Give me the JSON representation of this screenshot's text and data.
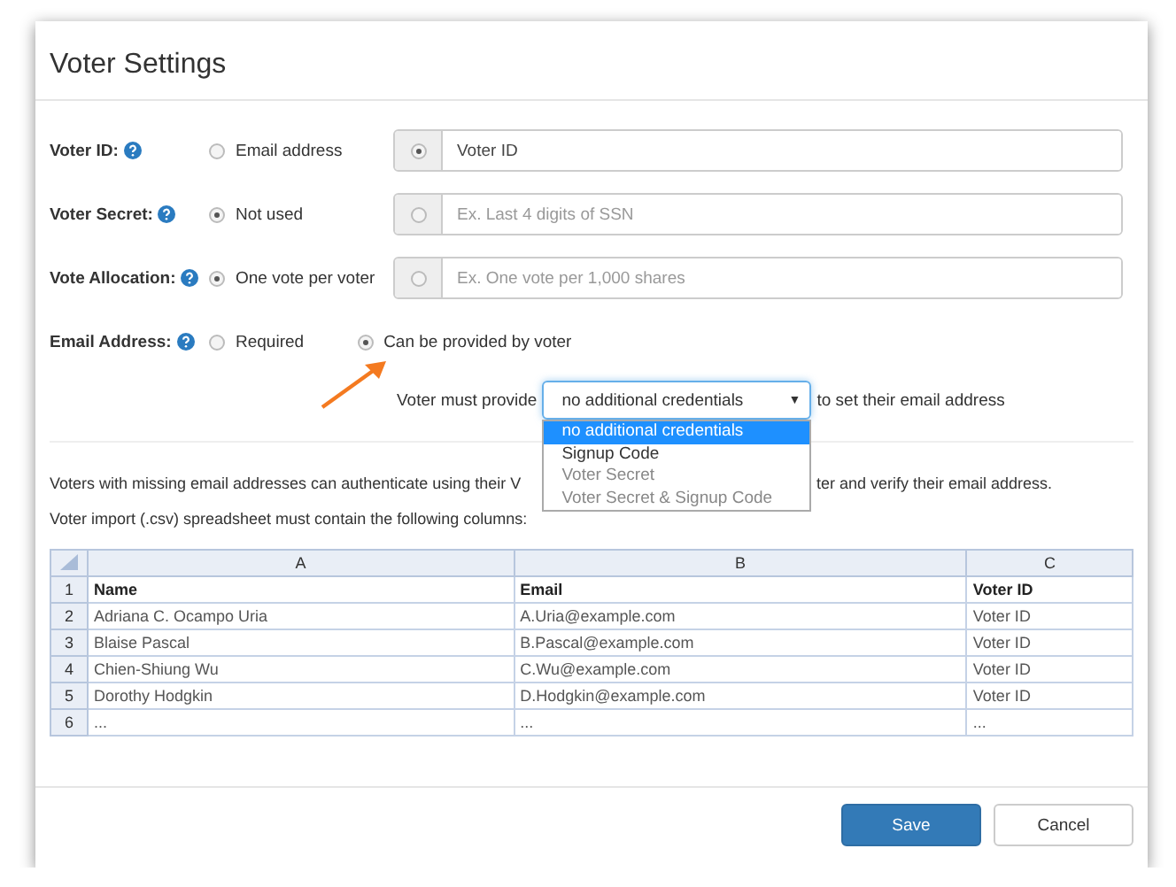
{
  "window": {
    "title": "Voter Settings"
  },
  "settings": [
    {
      "label": "Voter ID:",
      "options": [
        {
          "label": "Email address",
          "selected": false
        }
      ],
      "field": {
        "selected": true,
        "value": "Voter ID"
      }
    },
    {
      "label": "Voter Secret:",
      "options": [
        {
          "label": "Not used",
          "selected": true
        }
      ],
      "field": {
        "selected": false,
        "placeholder": "Ex. Last 4 digits of SSN"
      }
    },
    {
      "label": "Vote Allocation:",
      "options": [
        {
          "label": "One vote per voter",
          "selected": true
        }
      ],
      "field": {
        "selected": false,
        "placeholder": "Ex. One vote per 1,000 shares"
      }
    },
    {
      "label": "Email Address:",
      "options": [
        {
          "label": "Required",
          "selected": false
        },
        {
          "label": "Can be provided by voter",
          "selected": true
        }
      ]
    }
  ],
  "credentials": {
    "prefix": "Voter must provide",
    "select": {
      "value": "no additional credentials",
      "caret": "▼",
      "expanded": true,
      "options": [
        {
          "label": "no additional credentials",
          "selected": true,
          "disabled": false
        },
        {
          "label": "Signup Code",
          "selected": false,
          "disabled": false
        },
        {
          "label": "Voter Secret",
          "selected": false,
          "disabled": true
        },
        {
          "label": "Voter Secret & Signup Code",
          "selected": false,
          "disabled": true
        }
      ]
    },
    "suffix": "to set their email address"
  },
  "notes": [
    {
      "before": "Voters with missing email addresses can authenticate using their V",
      "after": "ter and verify their email address."
    },
    {
      "before": "Voter import (.csv) spreadsheet must contain the following columns:"
    }
  ],
  "spreadsheet": {
    "columns": [
      "A",
      "B",
      "C"
    ],
    "rows": [
      {
        "number": "1",
        "kind": "header",
        "cells": [
          "Name",
          "Email",
          "Voter ID"
        ]
      },
      {
        "number": "2",
        "kind": "data",
        "cells": [
          "Adriana C. Ocampo Uria",
          "A.Uria@example.com",
          "Voter ID"
        ]
      },
      {
        "number": "3",
        "kind": "data",
        "cells": [
          "Blaise Pascal",
          "B.Pascal@example.com",
          "Voter ID"
        ]
      },
      {
        "number": "4",
        "kind": "data",
        "cells": [
          "Chien-Shiung Wu",
          "C.Wu@example.com",
          "Voter ID"
        ]
      },
      {
        "number": "5",
        "kind": "data",
        "cells": [
          "Dorothy Hodgkin",
          "D.Hodgkin@example.com",
          "Voter ID"
        ]
      },
      {
        "number": "6",
        "kind": "data",
        "cells": [
          "...",
          "...",
          "..."
        ]
      }
    ]
  },
  "buttons": [
    {
      "label": "Save",
      "kind": "primary"
    },
    {
      "label": "Cancel",
      "kind": "default"
    }
  ]
}
